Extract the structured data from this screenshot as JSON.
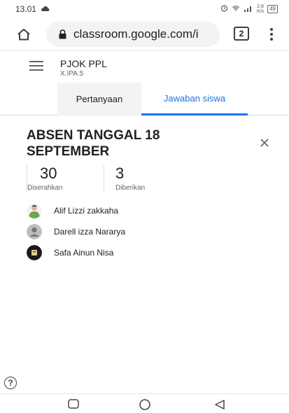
{
  "status_bar": {
    "time": "13.01",
    "speed_value": "2,8",
    "speed_unit": "K/s",
    "battery": "49"
  },
  "browser": {
    "url": "classroom.google.com/і",
    "tab_count": "2"
  },
  "class": {
    "name": "PJOK PPL",
    "section": "X.IPA.5"
  },
  "tabs": [
    {
      "label": "Pertanyaan",
      "active": false
    },
    {
      "label": "Jawaban siswa",
      "active": true
    }
  ],
  "assignment": {
    "title": "ABSEN TANGGAL 18 SEPTEMBER"
  },
  "stats": [
    {
      "value": "30",
      "label": "Diserahkan"
    },
    {
      "value": "3",
      "label": "Diberikan"
    }
  ],
  "students": [
    {
      "name": "Alif Lizzi zakkaha",
      "avatar": "photo-avatar"
    },
    {
      "name": "Darell izza Nararya",
      "avatar": "default-avatar"
    },
    {
      "name": "Safa Ainun Nisa",
      "avatar": "photo-avatar"
    }
  ],
  "colors": {
    "accent": "#1a73e8",
    "tab_active_bg": "#f1f3f4"
  }
}
